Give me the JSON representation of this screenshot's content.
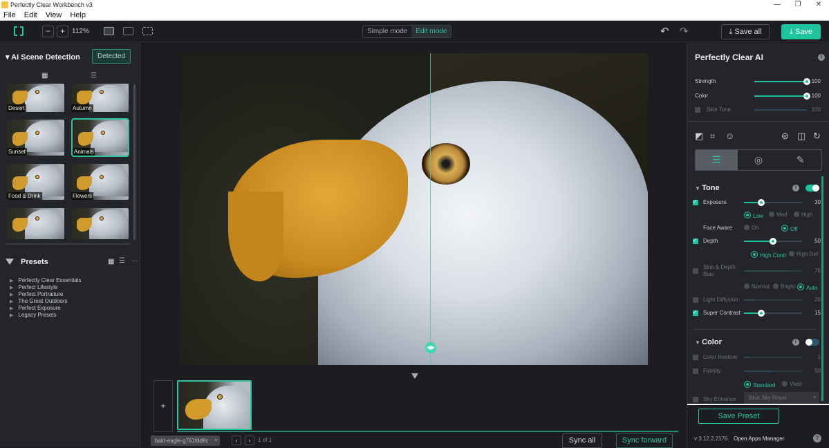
{
  "app": {
    "title": "Perfectly Clear Workbench v3"
  },
  "window": {
    "minimize": "—",
    "restore": "❐",
    "close": "✕"
  },
  "menu": [
    "File",
    "Edit",
    "View",
    "Help"
  ],
  "toolbar": {
    "zoom_out": "−",
    "zoom_in": "+",
    "zoom_level": "112%",
    "modes": {
      "simple": "Simple mode",
      "edit": "Edit mode",
      "active": "edit"
    },
    "undo": "↶",
    "redo": "↷",
    "save_all": "⤓ Save all",
    "save": "⤓ Save"
  },
  "left_panel": {
    "scene_title": "▾ AI Scene Detection",
    "detected_button": "Detected",
    "grid_view_icon": "▦",
    "list_view_icon": "☰",
    "scenes": [
      {
        "label": "Desert",
        "selected": false
      },
      {
        "label": "Autumn",
        "selected": false
      },
      {
        "label": "Sunset",
        "selected": false
      },
      {
        "label": "Animals",
        "selected": true
      },
      {
        "label": "Food & Drink",
        "selected": false
      },
      {
        "label": "Flowers",
        "selected": false
      },
      {
        "label": "",
        "selected": false
      },
      {
        "label": "",
        "selected": false
      }
    ],
    "presets_title": "Presets",
    "presets_more": "···",
    "presets": [
      "Perfectly Clear Essentials",
      "Perfect Lifestyle",
      "Perfect Portraiture",
      "The Great Outdoors",
      "Perfect Exposure",
      "Legacy Presets"
    ]
  },
  "center": {
    "split_handle": "◀▶",
    "filmstrip": {
      "add": "+",
      "filename": "bald-eagle-g761fdd8c",
      "prev": "‹",
      "next": "›",
      "pager": "1 of 1",
      "sync_all": "Sync all",
      "sync_forward": "Sync forward"
    }
  },
  "right_panel": {
    "title": "Perfectly Clear AI",
    "info": "i",
    "strength": {
      "label": "Strength",
      "value": 100,
      "max": 100
    },
    "color": {
      "label": "Color",
      "value": 100,
      "max": 100
    },
    "skin_tone": {
      "label": "Skin Tone",
      "value": 100,
      "max": 100,
      "enabled": false
    },
    "tools": [
      "curves-icon",
      "crop-icon",
      "face-icon",
      "flip-vertical-icon",
      "flip-horizontal-icon",
      "rotate-icon"
    ],
    "tabs": [
      "adjustments",
      "retouch",
      "effects"
    ],
    "tone": {
      "title": "Tone",
      "enabled": true,
      "exposure": {
        "label": "Exposure",
        "value": 30,
        "max": 100,
        "enabled": true,
        "options": [
          "Low",
          "Med",
          "High"
        ],
        "selected": "Low"
      },
      "face_aware": {
        "label": "Face Aware",
        "options": [
          "On",
          "Off"
        ],
        "selected": "Off"
      },
      "depth": {
        "label": "Depth",
        "value": 50,
        "max": 100,
        "enabled": true,
        "options": [
          "High Contr",
          "High Def"
        ],
        "selected": "High Contr"
      },
      "skin_depth_bias": {
        "label1": "Skin & Depth",
        "label2": "Bias",
        "value": 76,
        "max": 100,
        "enabled": false,
        "options": [
          "Normal",
          "Bright",
          "Auto"
        ],
        "selected": "Auto"
      },
      "light_diffusion": {
        "label": "Light Diffusion",
        "value": 20,
        "max": 100,
        "enabled": false
      },
      "super_contrast": {
        "label": "Super Contrast",
        "value": 15,
        "max": 50,
        "enabled": true
      }
    },
    "color_section": {
      "title": "Color",
      "enabled": false,
      "color_restore": {
        "label": "Color Restore",
        "value": 1,
        "max": 10,
        "enabled": false
      },
      "fidelity": {
        "label": "Fidelity",
        "value": 50,
        "max": 100,
        "enabled": false,
        "options": [
          "Standard",
          "Vivid"
        ],
        "selected": "Standard"
      },
      "sky_enhance": {
        "label": "Sky Enhance",
        "value": "Blue Sky Royal",
        "enabled": false
      }
    },
    "save_preset": "Save Preset",
    "version": "v:3.12.2.2176",
    "open_apps_manager": "Open Apps Manager",
    "help": "?"
  }
}
